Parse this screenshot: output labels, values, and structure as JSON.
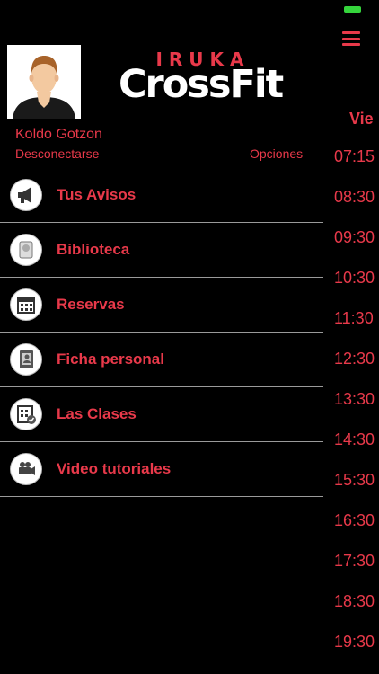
{
  "status": {
    "battery_color": "#35d43c"
  },
  "header": {
    "menu_icon": "hamburger-icon"
  },
  "logo": {
    "top": "IRUKA",
    "main": "CrossFit"
  },
  "user": {
    "name": "Koldo Gotzon",
    "logout": "Desconectarse",
    "options": "Opciones"
  },
  "menu": {
    "items": [
      {
        "label": "Tus Avisos",
        "icon": "megaphone-icon"
      },
      {
        "label": "Biblioteca",
        "icon": "book-icon"
      },
      {
        "label": "Reservas",
        "icon": "calendar-icon"
      },
      {
        "label": "Ficha personal",
        "icon": "contact-card-icon"
      },
      {
        "label": "Las Clases",
        "icon": "schedule-icon"
      },
      {
        "label": "Video tutoriales",
        "icon": "video-camera-icon"
      }
    ]
  },
  "schedule": {
    "day": "Vie",
    "times": [
      "07:15",
      "08:30",
      "09:30",
      "10:30",
      "11:30",
      "12:30",
      "13:30",
      "14:30",
      "15:30",
      "16:30",
      "17:30",
      "18:30",
      "19:30"
    ]
  },
  "colors": {
    "accent": "#e8394a",
    "background": "#000000",
    "divider": "#9a9a9a"
  }
}
